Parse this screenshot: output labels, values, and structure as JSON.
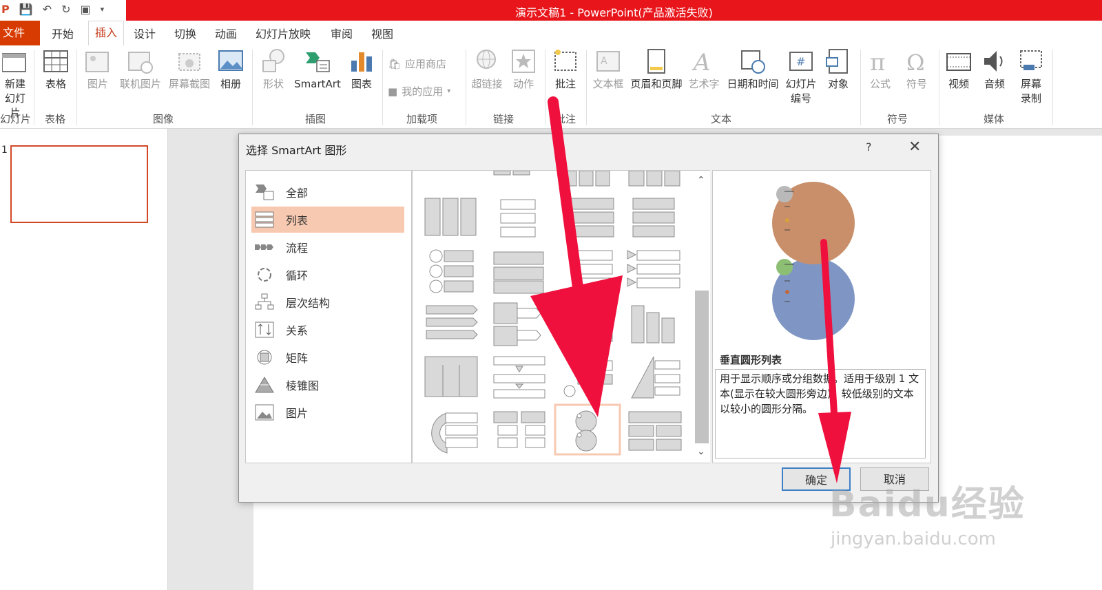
{
  "window": {
    "title": "演示文稿1 -  PowerPoint(产品激活失败)"
  },
  "quick_access": {
    "icons": [
      "app-icon",
      "save-icon",
      "undo-icon",
      "redo-icon",
      "present-icon"
    ]
  },
  "tabs": {
    "file": "文件",
    "items": [
      "开始",
      "插入",
      "设计",
      "切换",
      "动画",
      "幻灯片放映",
      "审阅",
      "视图"
    ],
    "active": "插入"
  },
  "ribbon": {
    "buttons": {
      "new_slide_1": "新建",
      "new_slide_2": "幻灯片",
      "table": "表格",
      "picture": "图片",
      "online_picture": "联机图片",
      "screenshot": "屏幕截图",
      "album": "相册",
      "shapes": "形状",
      "smartart": "SmartArt",
      "chart": "图表",
      "app_store": "应用商店",
      "my_apps": "我的应用",
      "hyperlink": "超链接",
      "action": "动作",
      "comment": "批注",
      "textbox": "文本框",
      "header_footer": "页眉和页脚",
      "wordart": "艺术字",
      "date_time": "日期和时间",
      "slide_number_1": "幻灯片",
      "slide_number_2": "编号",
      "object": "对象",
      "equation": "公式",
      "symbol": "符号",
      "video": "视频",
      "audio": "音频",
      "screen_record_1": "屏幕",
      "screen_record_2": "录制"
    },
    "groups": {
      "slides": "幻灯片",
      "tables": "表格",
      "images": "图像",
      "illustrations": "插图",
      "addins": "加载项",
      "links": "链接",
      "comments": "批注",
      "text": "文本",
      "symbols": "符号",
      "media": "媒体"
    }
  },
  "slides_pane": {
    "slide_number": "1"
  },
  "dialog": {
    "title": "选择 SmartArt 图形",
    "help": "?",
    "close": "✕",
    "categories": [
      {
        "label": "全部",
        "icon": "all-icon"
      },
      {
        "label": "列表",
        "icon": "list-icon"
      },
      {
        "label": "流程",
        "icon": "process-icon"
      },
      {
        "label": "循环",
        "icon": "cycle-icon"
      },
      {
        "label": "层次结构",
        "icon": "hierarchy-icon"
      },
      {
        "label": "关系",
        "icon": "relationship-icon"
      },
      {
        "label": "矩阵",
        "icon": "matrix-icon"
      },
      {
        "label": "棱锥图",
        "icon": "pyramid-icon"
      },
      {
        "label": "图片",
        "icon": "picture-icon"
      }
    ],
    "selected_category": "列表",
    "preview": {
      "name": "垂直圆形列表",
      "description": "用于显示顺序或分组数据。适用于级别 1 文本(显示在较大圆形旁边)。较低级别的文本以较小的圆形分隔。"
    },
    "ok": "确定",
    "cancel": "取消"
  },
  "watermark": {
    "brand": "Baidu经验",
    "url": "jingyan.baidu.com"
  },
  "colors": {
    "title_red": "#e8161b",
    "file_tab": "#d83b01",
    "accent_orange": "#d24726",
    "arrow_red": "#f0103d",
    "selection": "#f8c9b1"
  }
}
